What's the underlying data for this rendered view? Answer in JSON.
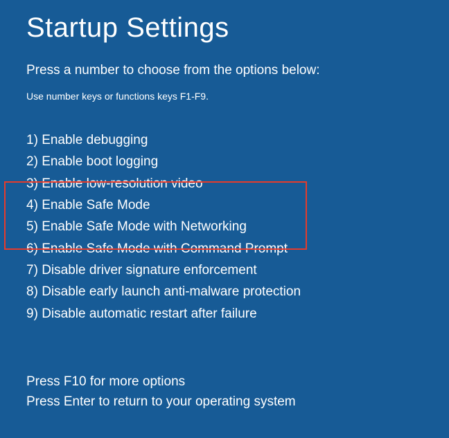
{
  "title": "Startup Settings",
  "subtitle": "Press a number to choose from the options below:",
  "hint": "Use number keys or functions keys F1-F9.",
  "options": [
    {
      "num": "1",
      "label": "Enable debugging"
    },
    {
      "num": "2",
      "label": "Enable boot logging"
    },
    {
      "num": "3",
      "label": "Enable low-resolution video"
    },
    {
      "num": "4",
      "label": "Enable Safe Mode"
    },
    {
      "num": "5",
      "label": "Enable Safe Mode with Networking"
    },
    {
      "num": "6",
      "label": "Enable Safe Mode with Command Prompt"
    },
    {
      "num": "7",
      "label": "Disable driver signature enforcement"
    },
    {
      "num": "8",
      "label": "Disable early launch anti-malware protection"
    },
    {
      "num": "9",
      "label": "Disable automatic restart after failure"
    }
  ],
  "footer": {
    "more": "Press F10 for more options",
    "return": "Press Enter to return to your operating system"
  },
  "highlight_color": "#e83b2a"
}
